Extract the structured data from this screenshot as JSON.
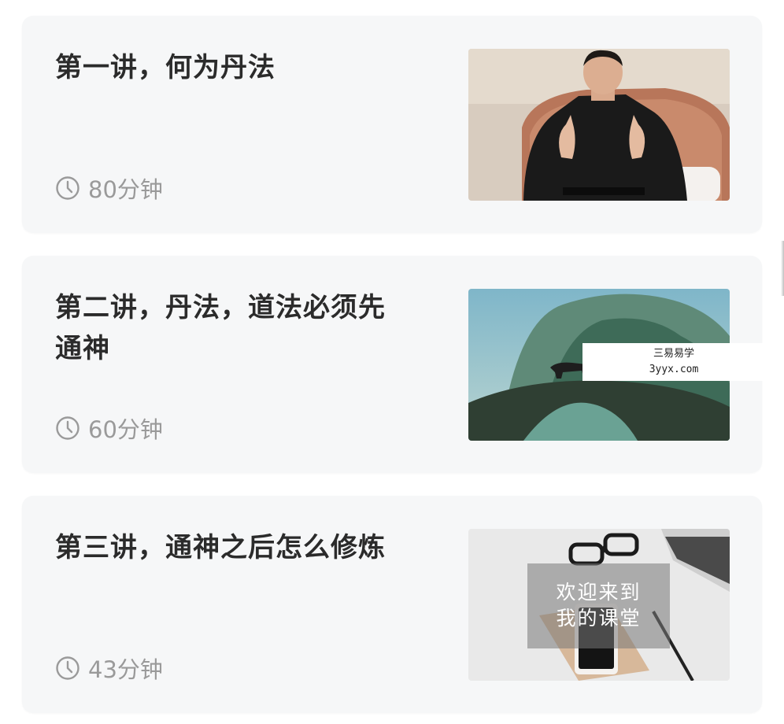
{
  "lessons": [
    {
      "title": "第一讲，何为丹法",
      "duration": "80分钟",
      "thumb_icon": "meditation-photo"
    },
    {
      "title": "第二讲，丹法，道法必须先通神",
      "duration": "60分钟",
      "thumb_icon": "landscape-bridge-photo"
    },
    {
      "title": "第三讲，通神之后怎么修炼",
      "duration": "43分钟",
      "thumb_icon": "desk-photo",
      "thumb_caption_line1": "欢迎来到",
      "thumb_caption_line2": "我的课堂"
    }
  ],
  "watermark": {
    "line1": "三易易学",
    "line2": "3yyx.com"
  },
  "colors": {
    "card_bg": "#f6f7f8",
    "title": "#2b2b2b",
    "meta": "#9a9a9a"
  }
}
